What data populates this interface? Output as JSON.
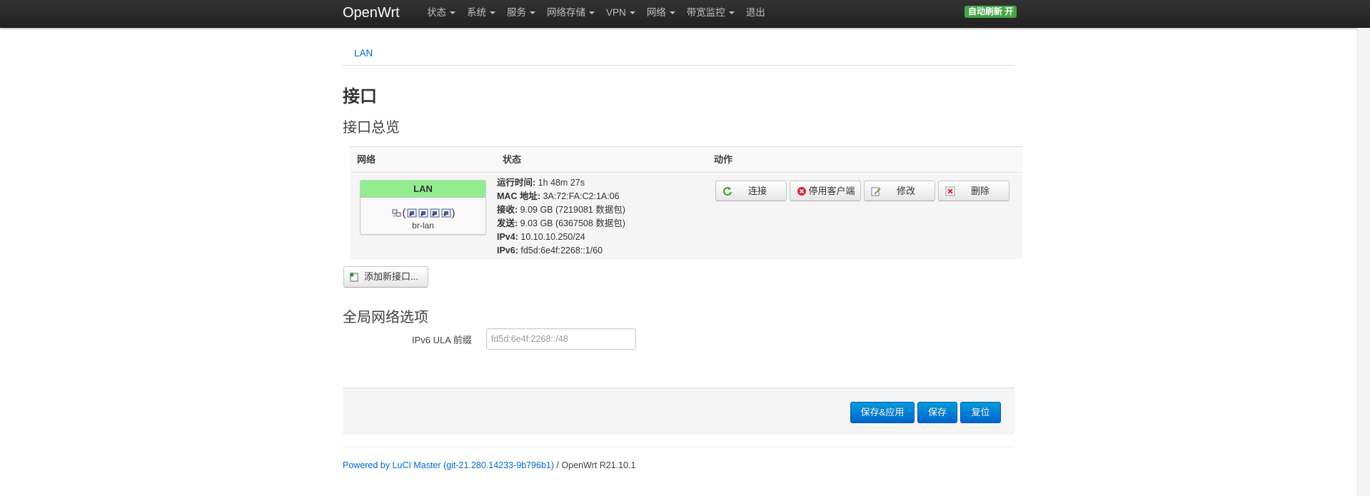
{
  "navbar": {
    "brand": "OpenWrt",
    "menu": [
      "状态",
      "系统",
      "服务",
      "网络存储",
      "VPN",
      "网络",
      "带宽监控",
      "退出"
    ],
    "auto_refresh": "自动刷新 开",
    "auto_refresh_color": "#46a546"
  },
  "tabs": [
    {
      "label": "LAN"
    }
  ],
  "page": {
    "title": "接口",
    "overview_title": "接口总览",
    "global_title": "全局网络选项"
  },
  "iface_table": {
    "headers": {
      "network": "网络",
      "status": "状态",
      "actions": "动作"
    },
    "row": {
      "name": "LAN",
      "name_bg_color": "#90ee90",
      "device": "br-lan",
      "device_icons": [
        "bridge-icon",
        "port-icon",
        "port-icon",
        "port-icon",
        "port-icon"
      ],
      "status": [
        {
          "label": "运行时间:",
          "value": "1h 48m 27s"
        },
        {
          "label": "MAC 地址:",
          "value": "3A:72:FA:C2:1A:06"
        },
        {
          "label": "接收:",
          "value": "9.09 GB (7219081 数据包)"
        },
        {
          "label": "发送:",
          "value": "9.03 GB (6367508 数据包)"
        },
        {
          "label": "IPv4:",
          "value": "10.10.10.250/24"
        },
        {
          "label": "IPv6:",
          "value": "fd5d:6e4f:2268::1/60"
        }
      ],
      "actions": [
        {
          "label": "连接",
          "icon": "reload-icon"
        },
        {
          "label": "停用客户端",
          "icon": "stop-icon"
        },
        {
          "label": "修改",
          "icon": "edit-icon"
        },
        {
          "label": "删除",
          "icon": "delete-icon"
        }
      ]
    }
  },
  "add_button": "添加新接口...",
  "ula": {
    "label": "IPv6 ULA 前缀",
    "value": "",
    "placeholder": "fd5d:6e4f:2268::/48"
  },
  "form_actions": {
    "save_apply": "保存&应用",
    "save": "保存",
    "reset": "复位",
    "primary_color": "#0064cd"
  },
  "footer": {
    "link_text": "Powered by LuCI Master (git-21.280.14233-9b796b1)",
    "rest_text": " / OpenWrt R21.10.1"
  }
}
